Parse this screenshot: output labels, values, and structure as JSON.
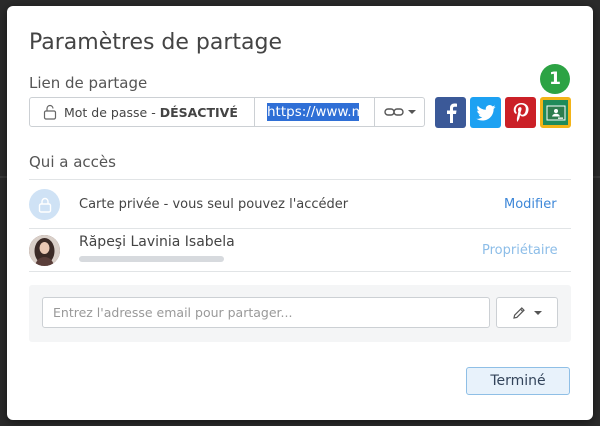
{
  "dialog": {
    "title": "Paramètres de partage",
    "share_link_label": "Lien de partage",
    "password_prefix": "Mot de passe -",
    "password_state": "DÉSACTIVÉ",
    "url_value": "https://www.m",
    "step_badge": "1",
    "social": [
      "facebook-icon",
      "twitter-icon",
      "pinterest-icon",
      "google-classroom-icon"
    ],
    "access_label": "Qui a accès",
    "private_text": "Carte privée - vous seul pouvez l'accéder",
    "modify_link": "Modifier",
    "owner_name": "Răpeşi Lavinia Isabela",
    "owner_role": "Propriétaire",
    "email_placeholder": "Entrez l'adresse email pour partager...",
    "done_button": "Terminé"
  },
  "colors": {
    "facebook": "#3b5998",
    "twitter": "#1da1f2",
    "pinterest": "#cb2027",
    "classroom": "#1f8b5a",
    "highlight": "#f3b418",
    "badge": "#2ca344",
    "link": "#3d87d8"
  }
}
